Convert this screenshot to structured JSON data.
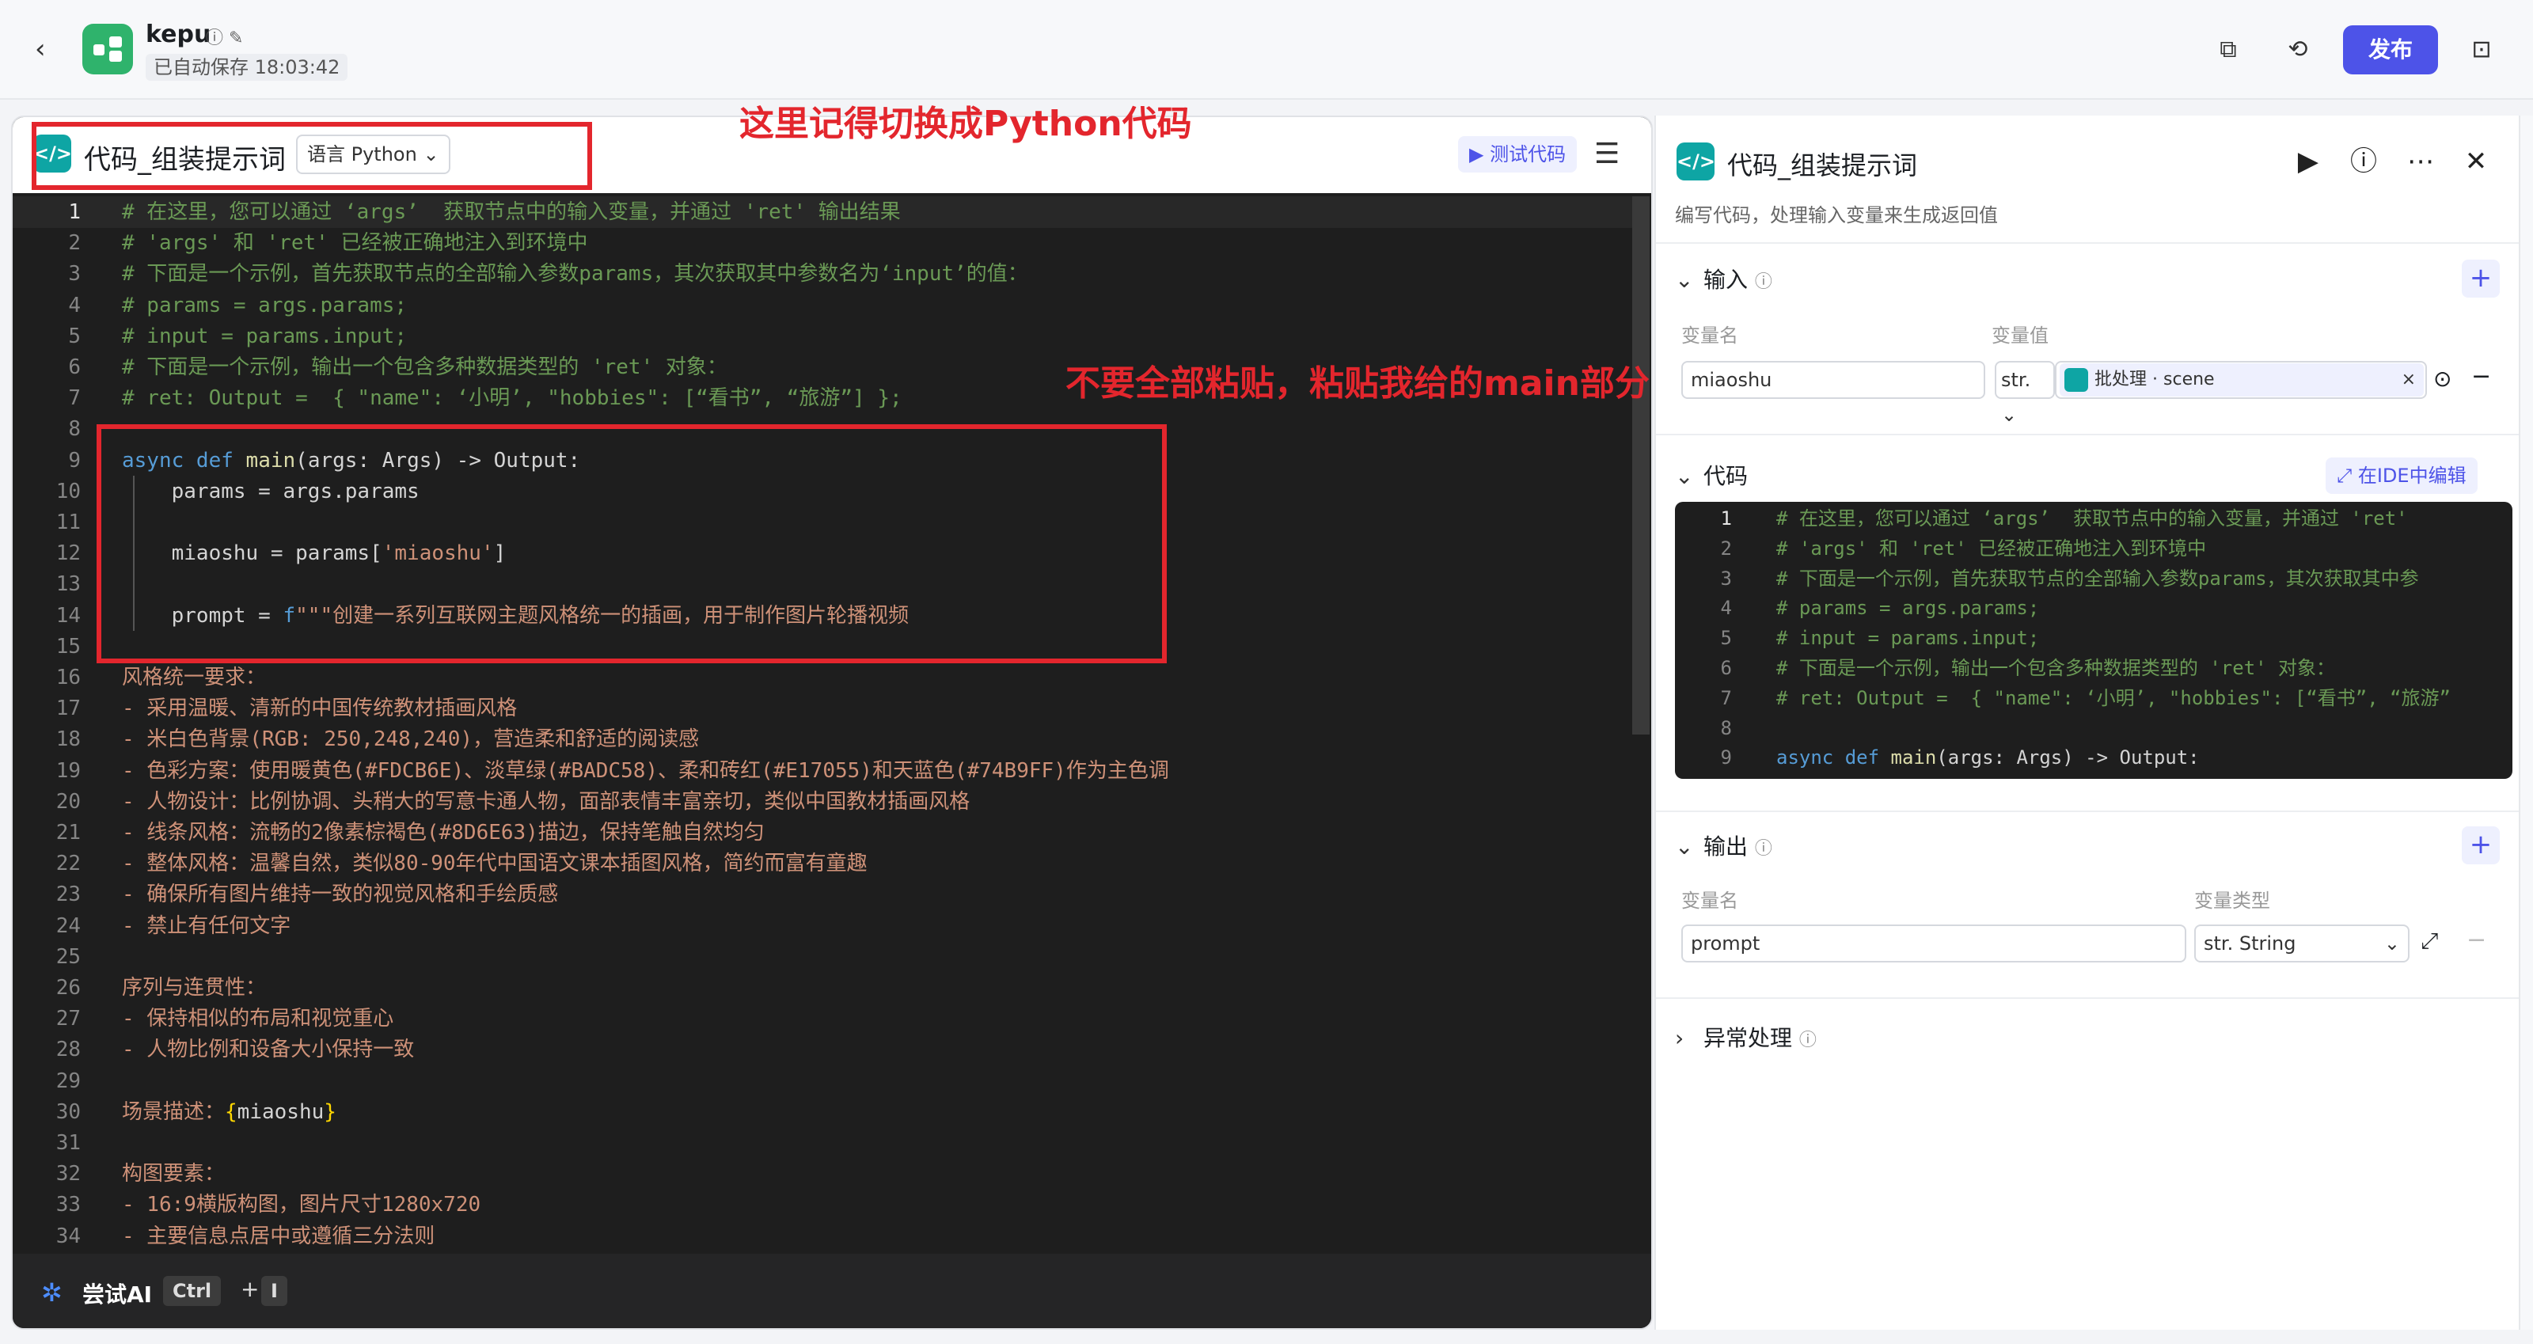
{
  "header": {
    "app_name": "kepu",
    "autosave": "已自动保存 18:03:42",
    "publish_label": "发布"
  },
  "editor": {
    "title": "代码_组装提示词",
    "language": "语言 Python",
    "test_label": "测试代码",
    "try_ai": "尝试AI",
    "kbd_ctrl": "Ctrl",
    "kbd_plus": "+",
    "kbd_i": "I",
    "line_numbers": [
      "1",
      "2",
      "3",
      "4",
      "5",
      "6",
      "7",
      "8",
      "9",
      "10",
      "11",
      "12",
      "13",
      "14",
      "15",
      "16",
      "17",
      "18",
      "19",
      "20",
      "21",
      "22",
      "23",
      "24",
      "25",
      "26",
      "27",
      "28",
      "29",
      "30",
      "31",
      "32",
      "33",
      "34"
    ],
    "lines": [
      "# 在这里，您可以通过 ‘args’  获取节点中的输入变量，并通过 'ret' 输出结果",
      "# 'args' 和 'ret' 已经被正确地注入到环境中",
      "# 下面是一个示例，首先获取节点的全部输入参数params，其次获取其中参数名为‘input’的值：",
      "# params = args.params;",
      "# input = params.input;",
      "# 下面是一个示例，输出一个包含多种数据类型的 'ret' 对象：",
      "# ret: Output =  { \"name\": ‘小明’, \"hobbies\": [“看书”, “旅游”] };",
      "",
      "async def main(args: Args) -> Output:",
      "    params = args.params",
      "",
      "    miaoshu = params['miaoshu']",
      "",
      "    prompt = f\"\"\"创建一系列互联网主题风格统一的插画，用于制作图片轮播视频",
      "",
      "风格统一要求：",
      "- 采用温暖、清新的中国传统教材插画风格",
      "- 米白色背景(RGB: 250,248,240)，营造柔和舒适的阅读感",
      "- 色彩方案：使用暖黄色(#FDCB6E)、淡草绿(#BADC58)、柔和砖红(#E17055)和天蓝色(#74B9FF)作为主色调",
      "- 人物设计：比例协调、头稍大的写意卡通人物，面部表情丰富亲切，类似中国教材插画风格",
      "- 线条风格：流畅的2像素棕褐色(#8D6E63)描边，保持笔触自然均匀",
      "- 整体风格：温馨自然，类似80-90年代中国语文课本插图风格，简约而富有童趣",
      "- 确保所有图片维持一致的视觉风格和手绘质感",
      "- 禁止有任何文字",
      "",
      "序列与连贯性：",
      "- 保持相似的布局和视觉重心",
      "- 人物比例和设备大小保持一致",
      "",
      "场景描述：{miaoshu}",
      "",
      "构图要素：",
      "- 16:9横版构图，图片尺寸1280x720",
      "- 主要信息点居中或遵循三分法则"
    ]
  },
  "annotations": {
    "note_top": "这里记得切换成Python代码",
    "note_mid": "不要全部粘贴，粘贴我给的main部分"
  },
  "panel": {
    "title": "代码_组装提示词",
    "description": "编写代码，处理输入变量来生成返回值",
    "input_section": "输入",
    "var_name_label": "变量名",
    "var_value_label": "变量值",
    "input_var_name": "miaoshu",
    "input_type": "str.",
    "input_ref_node": "批处理",
    "input_ref_sep": "·",
    "input_ref_var": "scene",
    "code_section": "代码",
    "ide_label": "在IDE中编辑",
    "mini_line_numbers": [
      "1",
      "2",
      "3",
      "4",
      "5",
      "6",
      "7",
      "8",
      "9"
    ],
    "mini_lines": [
      "# 在这里，您可以通过 ‘args’  获取节点中的输入变量，并通过 'ret'",
      "# 'args' 和 'ret' 已经被正确地注入到环境中",
      "# 下面是一个示例，首先获取节点的全部输入参数params，其次获取其中参",
      "# params = args.params;",
      "# input = params.input;",
      "# 下面是一个示例，输出一个包含多种数据类型的 'ret' 对象：",
      "# ret: Output =  { \"name\": ‘小明’, \"hobbies\": [“看书”, “旅游”",
      "",
      "async def main(args: Args) -> Output:"
    ],
    "output_section": "输出",
    "output_type_label": "变量类型",
    "output_var_name": "prompt",
    "output_type": "str. String",
    "exception_section": "异常处理"
  }
}
